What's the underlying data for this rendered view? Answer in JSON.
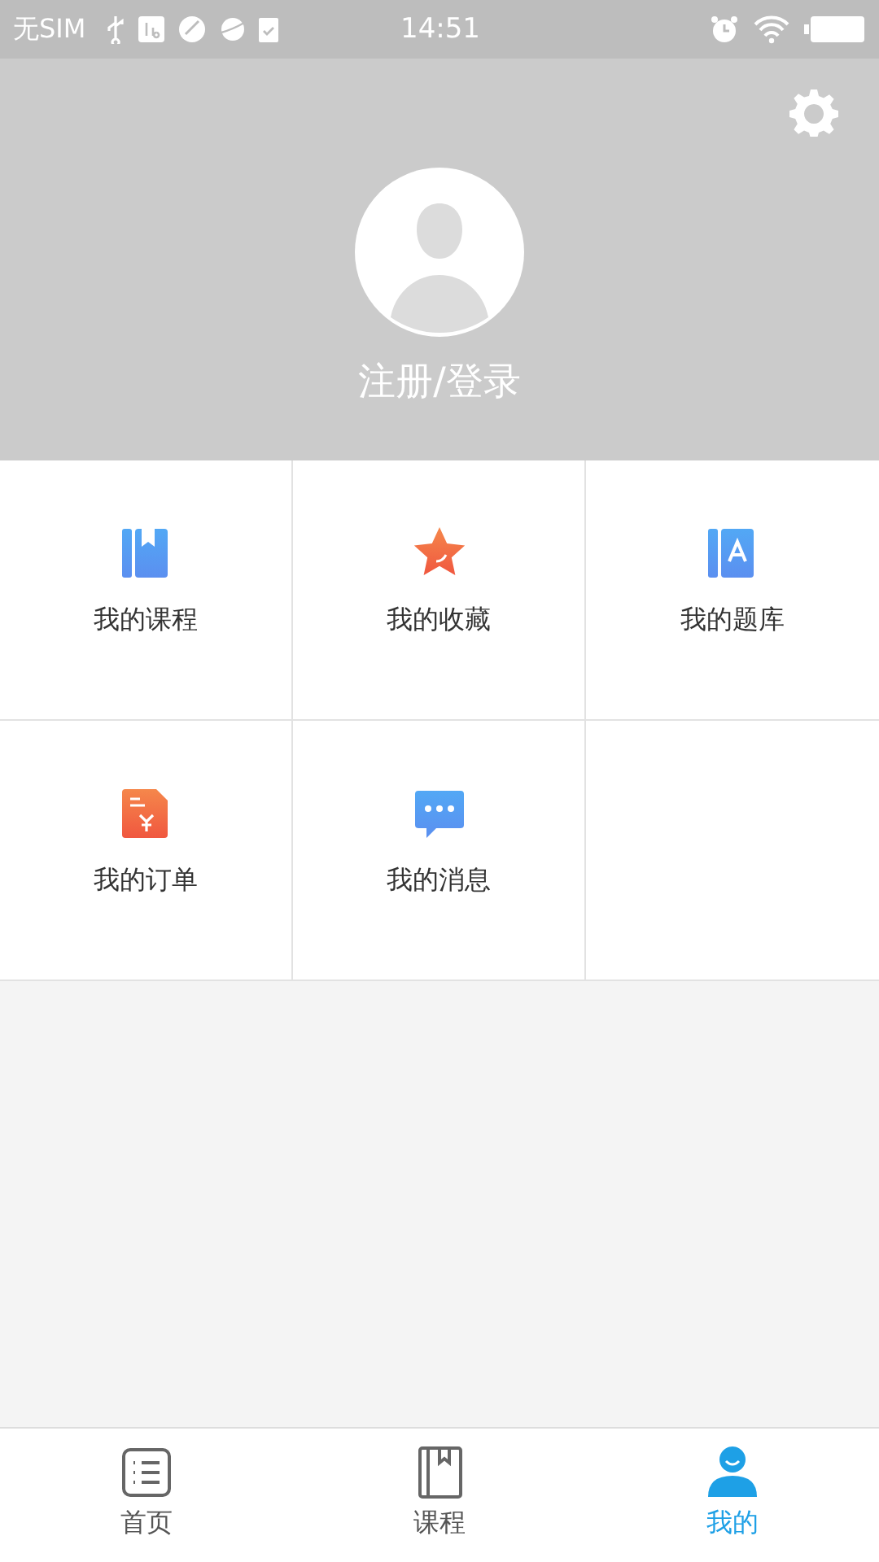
{
  "status_bar": {
    "carrier": "无SIM",
    "time": "14:51"
  },
  "profile": {
    "login_label": "注册/登录"
  },
  "menu_grid": [
    {
      "label": "我的课程"
    },
    {
      "label": "我的收藏"
    },
    {
      "label": "我的题库"
    },
    {
      "label": "我的订单"
    },
    {
      "label": "我的消息"
    }
  ],
  "tab_bar": [
    {
      "label": "首页",
      "selected": false
    },
    {
      "label": "课程",
      "selected": false
    },
    {
      "label": "我的",
      "selected": true
    }
  ]
}
